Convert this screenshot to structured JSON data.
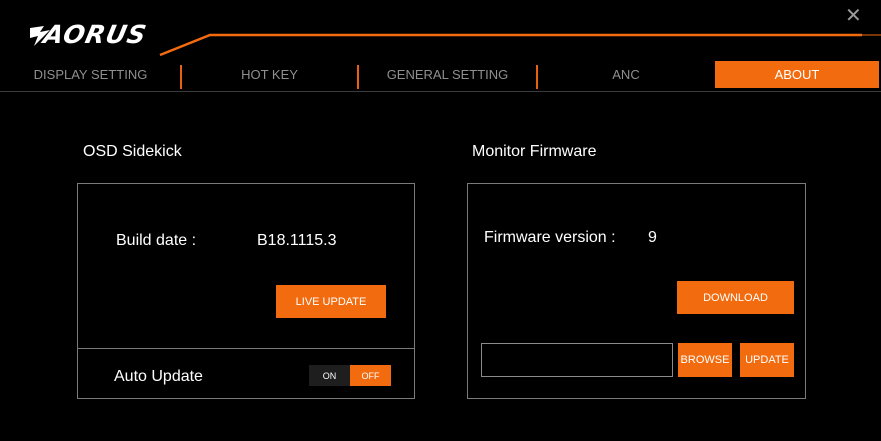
{
  "app": {
    "logo_text": "AORUS",
    "close_glyph": "✕"
  },
  "tabs": [
    {
      "label": "DISPLAY SETTING",
      "active": false
    },
    {
      "label": "HOT KEY",
      "active": false
    },
    {
      "label": "GENERAL SETTING",
      "active": false
    },
    {
      "label": "ANC",
      "active": false
    },
    {
      "label": "ABOUT",
      "active": true
    }
  ],
  "osd": {
    "title": "OSD Sidekick",
    "build_label": "Build date :",
    "build_value": "B18.1115.3",
    "live_update_label": "LIVE UPDATE",
    "auto_update_label": "Auto Update",
    "toggle_on": "ON",
    "toggle_off": "OFF",
    "auto_update_state": "OFF"
  },
  "firmware": {
    "title": "Monitor Firmware",
    "version_label": "Firmware version :",
    "version_value": "9",
    "download_label": "DOWNLOAD",
    "file_path_value": "",
    "browse_label": "BROWSE",
    "update_label": "UPDATE"
  },
  "colors": {
    "accent": "#f26b0f",
    "background": "#000000",
    "border": "#7a7a7a",
    "inactive_tab_text": "#8f8f8f"
  }
}
